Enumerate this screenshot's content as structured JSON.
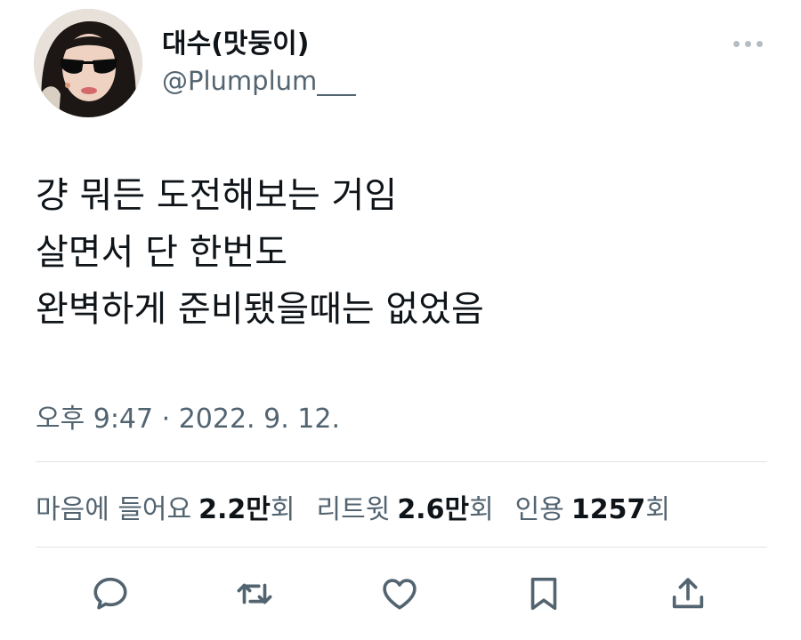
{
  "author": {
    "display_name": "대수(맛둥이)",
    "handle": "@Plumplum___"
  },
  "tweet": {
    "lines": [
      "걍 뭐든 도전해보는 거임",
      "살면서 단 한번도",
      "완벽하게 준비됐을때는 없었음"
    ],
    "timestamp": "오후 9:47 · 2022. 9. 12."
  },
  "stats": {
    "likes": {
      "label": "마음에 들어요",
      "count": "2.2만",
      "unit": "회"
    },
    "retweets": {
      "label": "리트윗",
      "count": "2.6만",
      "unit": "회"
    },
    "quotes": {
      "label": "인용",
      "count": "1257",
      "unit": "회"
    }
  },
  "actions": {
    "icons": [
      "reply-icon",
      "retweet-icon",
      "like-icon",
      "bookmark-icon",
      "share-icon"
    ]
  },
  "colors": {
    "text_primary": "#0f1419",
    "text_secondary": "#536471",
    "divider": "#dfe3e6",
    "icon": "#536471"
  }
}
